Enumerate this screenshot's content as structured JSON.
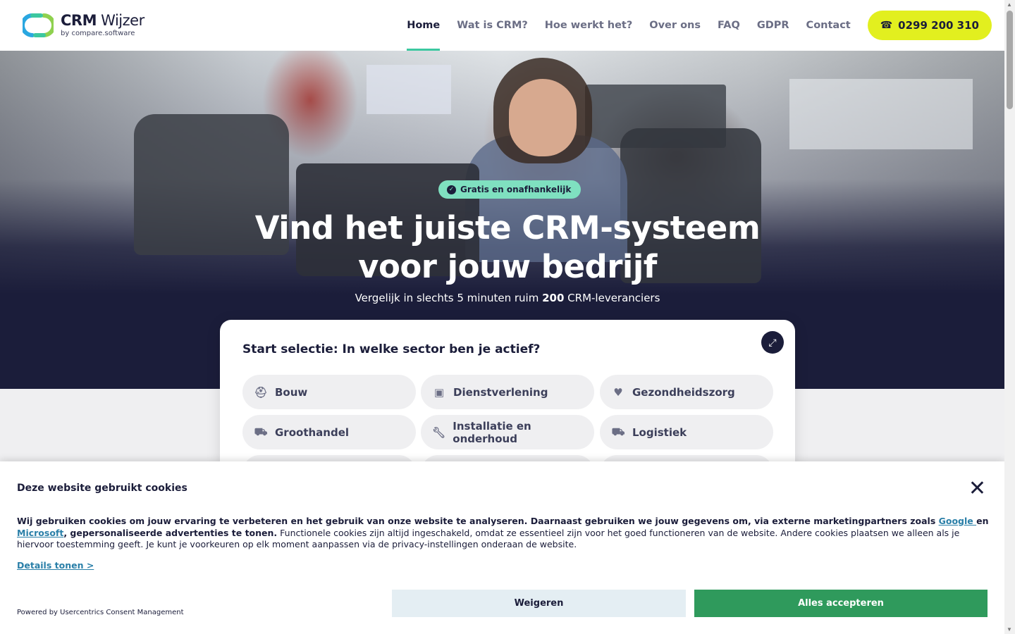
{
  "brand": {
    "name_bold": "CRM",
    "name_rest": " Wijzer",
    "sub": "by compare.software"
  },
  "nav": {
    "items": [
      {
        "label": "Home",
        "active": true
      },
      {
        "label": "Wat is CRM?"
      },
      {
        "label": "Hoe werkt het?"
      },
      {
        "label": "Over ons"
      },
      {
        "label": "FAQ"
      },
      {
        "label": "GDPR"
      },
      {
        "label": "Contact"
      }
    ],
    "phone": "0299 200 310"
  },
  "hero": {
    "badge": "Gratis en onafhankelijk",
    "title_line1": "Vind het juiste CRM-systeem",
    "title_line2": "voor jouw bedrijf",
    "sub_before": "Vergelijk in slechts 5 minuten ruim ",
    "sub_bold": "200",
    "sub_after": " CRM-leveranciers"
  },
  "selection": {
    "title": "Start selectie: In welke sector ben je actief?",
    "sectors": [
      {
        "label": "Bouw",
        "icon": "helmet-icon"
      },
      {
        "label": "Dienstverlening",
        "icon": "briefcase-icon"
      },
      {
        "label": "Gezondheidszorg",
        "icon": "heartbeat-icon"
      },
      {
        "label": "Groothandel",
        "icon": "forklift-icon"
      },
      {
        "label": "Installatie en onderhoud",
        "icon": "wrench-icon"
      },
      {
        "label": "Logistiek",
        "icon": "truck-icon"
      }
    ]
  },
  "cookie": {
    "title": "Deze website gebruikt cookies",
    "text_bold_1": "Wij gebruiken cookies om jouw ervaring te verbeteren en het gebruik van onze website te analyseren. Daarnaast gebruiken we jouw gegevens om, via externe marketingpartners zoals ",
    "link_google": "Google ",
    "text_bold_2": "en ",
    "link_microsoft": "Microsoft",
    "text_bold_3": ", gepersonaliseerde advertenties te tonen.",
    "text_normal": " Functionele cookies zijn altijd ingeschakeld, omdat ze essentieel zijn voor het goed functioneren van de website. Andere cookies plaatsen we alleen als je hiervoor toestemming geeft. Je kunt je voorkeuren op elk moment aanpassen via de privacy-instellingen onderaan de website.",
    "details": "Details tonen >",
    "powered": "Powered by Usercentrics Consent Management",
    "reject": "Weigeren",
    "accept": "Alles accepteren"
  },
  "colors": {
    "navy": "#1b1d3a",
    "accent_green": "#3cc8a0",
    "phone_yellow": "#e2ef1f",
    "badge_mint": "#7fe0c0",
    "accept_green": "#2f9a5c",
    "reject_bg": "#e4eef3",
    "link_blue": "#2a7fa8"
  }
}
